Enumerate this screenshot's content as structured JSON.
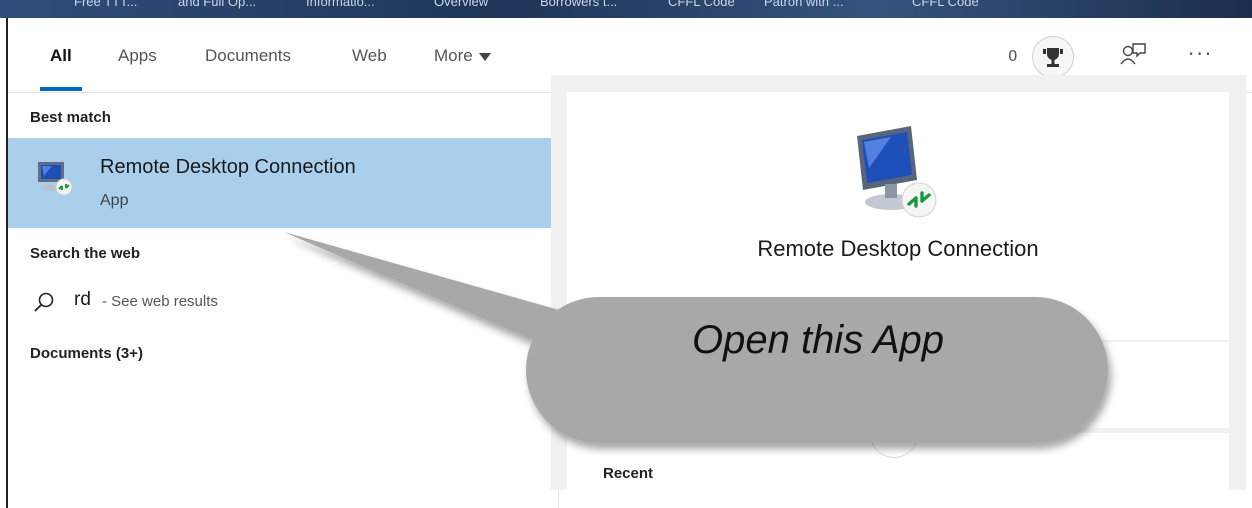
{
  "bookmarks": [
    "Free TTT...",
    "and Full Op...",
    "Informatio...",
    "Overview",
    "Borrowers t...",
    "CFFL Code",
    "Patron with ...",
    "CFFL Code"
  ],
  "tabs": {
    "all": "All",
    "apps": "Apps",
    "documents": "Documents",
    "web": "Web",
    "more": "More"
  },
  "header": {
    "points": "0",
    "trophy_icon": "trophy-icon",
    "feedback_icon": "feedback-icon",
    "more_options": "···"
  },
  "results": {
    "best_match_header": "Best match",
    "best_match": {
      "title": "Remote Desktop Connection",
      "subtitle": "App",
      "icon": "remote-desktop-icon"
    },
    "search_web_header": "Search the web",
    "web_result": {
      "term": "rd",
      "hint": "- See web results"
    },
    "documents_header": "Documents (3+)"
  },
  "preview": {
    "title": "Remote Desktop Connection",
    "recent_header": "Recent"
  },
  "callout": {
    "text": "Open this App"
  },
  "colors": {
    "selected_row": "#a9cfed",
    "accent": "#0067c0",
    "callout_fill": "#a8a8a8"
  }
}
